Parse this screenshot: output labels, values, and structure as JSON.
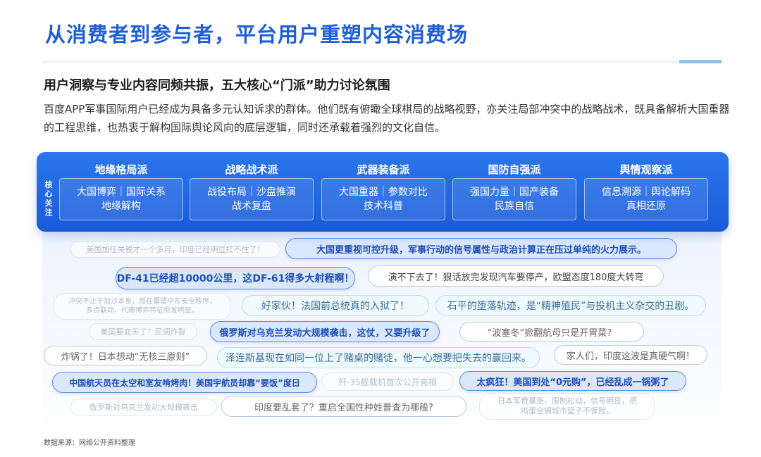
{
  "title": "从消费者到参与者，平台用户重塑内容消费场",
  "subtitle": "用户洞察与专业内容同频共振，五大核心“门派”助力讨论氛围",
  "description": "百度APP军事国际用户已经成为具备多元认知诉求的群体。他们既有俯瞰全球棋局的战略视野，亦关注局部冲突中的战略战术，既具备解析大国重器的工程思维，也热衷于解构国际舆论风向的底层逻辑，同时还承载着强烈的文化自信。",
  "panel": {
    "side_label": "核心关注",
    "columns": [
      {
        "name": "地缘格局派",
        "line1": "大国博弈｜国际关系",
        "line2": "地缘解构"
      },
      {
        "name": "战略战术派",
        "line1": "战役布局｜沙盘推演",
        "line2": "战术复盘"
      },
      {
        "name": "武器装备派",
        "line1": "大国重器｜参数对比",
        "line2": "技术科普"
      },
      {
        "name": "国防自强派",
        "line1": "强国力量｜国产装备",
        "line2": "民族自信"
      },
      {
        "name": "舆情观察派",
        "line1": "信息溯源｜舆论解码",
        "line2": "真相还原"
      }
    ]
  },
  "comments": [
    "美国加征关税才一个多月，印度已经明显扛不住了！",
    "大国更重视可控升级，军事行动的信号属性与政治计算正在压过单纯的火力展示。",
    "DF-41已经超10000公里，这DF-61得多大射程啊！",
    "演不下去了！狠话放完发现汽车要停产，欧盟态度180度大转弯",
    "冲突不止于加沙本身，而在重塑中东安全秩序，",
    "多点联动、代理博弈特征愈发明显。",
    "好家伙！法国前总统真的入狱了！",
    "石平的堕落轨迹，是“精神殖民”与投机主义杂交的丑剧。",
    "美国要变天了？民调炸裂",
    "俄罗斯对乌克兰发动大规模袭击，这仗，又要升级了",
    "“波塞冬”掀翻航母只是开胃菜？",
    "炸锅了！日本想动“无核三原则”",
    "泽连斯基现在如同一位上了赌桌的赌徒，他一心想要把失去的赢回来。",
    "家人们，印度这波是真硬气啊！",
    "中国航天员在太空和室友啃烤肉！美国宇航员却靠“要饭”度日",
    "歼-35舰载机首次公开亮相",
    "太疯狂！美国到处“0元购”，已经乱成一锅粥了",
    "俄罗斯对乌克兰发动大规模袭击",
    "印度要乱套了？重启全国性种姓普查为哪般?",
    "日本军费暴涨、限制松动，信号明显，把",
    "鸡蛋全搁城市篮子不保险。"
  ],
  "source": "数据来源：网络公开资料整理",
  "colors": {
    "title_blue": "#1f5fd6",
    "panel_blue": "#1a5bd8",
    "pill_border": "#5a8de0"
  }
}
